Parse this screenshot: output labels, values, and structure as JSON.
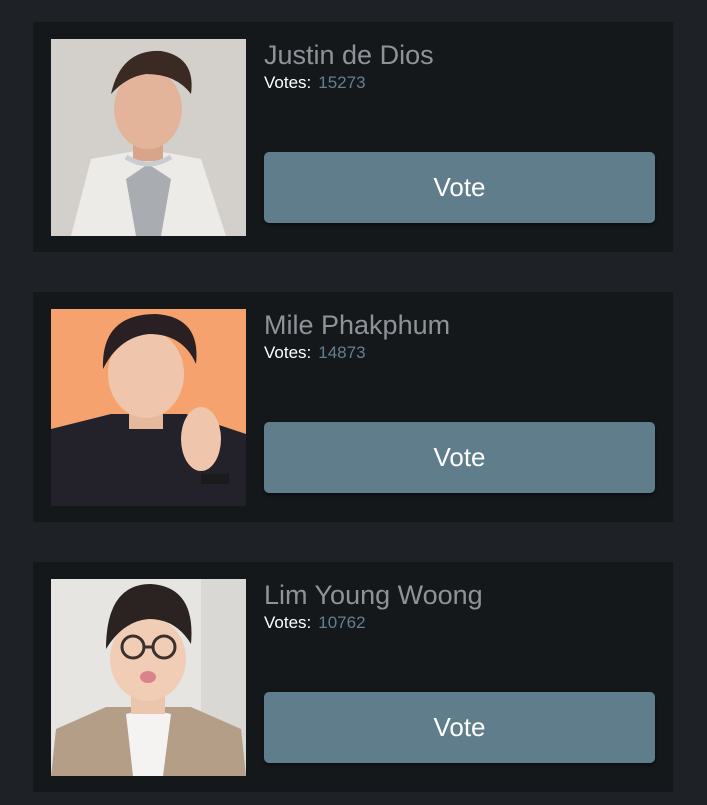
{
  "colors": {
    "background": "#1e2226",
    "card": "#15181b",
    "name_text": "#8e9398",
    "votes_label": "#ffffff",
    "votes_value": "#63808f",
    "button": "#607d8b"
  },
  "candidates": [
    {
      "name": "Justin de Dios",
      "votes_label": "Votes:",
      "votes": "15273",
      "button_label": "Vote",
      "photo": "portrait-photo"
    },
    {
      "name": "Mile Phakphum",
      "votes_label": "Votes:",
      "votes": "14873",
      "button_label": "Vote",
      "photo": "portrait-photo"
    },
    {
      "name": "Lim Young Woong",
      "votes_label": "Votes:",
      "votes": "10762",
      "button_label": "Vote",
      "photo": "portrait-photo"
    }
  ]
}
